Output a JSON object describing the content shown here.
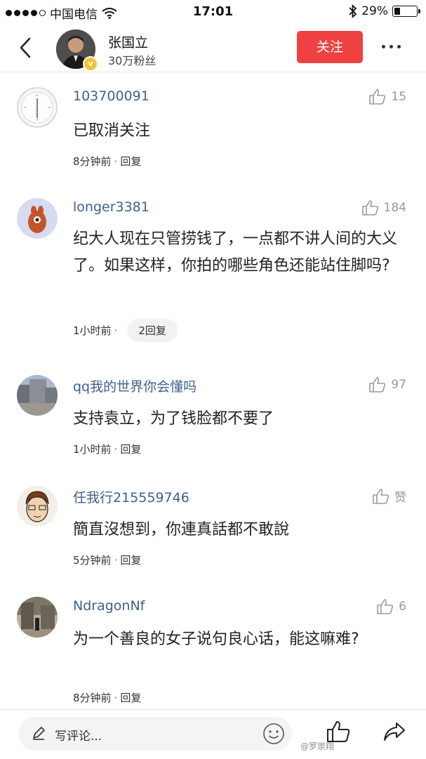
{
  "status_bar": {
    "carrier": "中国电信",
    "time": "17:01",
    "battery": "29%",
    "battery_level": 0.29
  },
  "header": {
    "author_name": "张国立",
    "author_fans": "30万粉丝",
    "follow_label": "关注"
  },
  "comments": [
    {
      "name": "103700091",
      "likes": "15",
      "text": "已取消关注",
      "time": "8分钟前",
      "sep": "·",
      "reply": "回复"
    },
    {
      "name": "longer3381",
      "likes": "184",
      "text": "纪大人现在只管捞钱了，一点都不讲人间的大义了。如果这样，你拍的哪些角色还能站住脚吗?",
      "time": "1小时前",
      "sep": "·",
      "reply": "2回复"
    },
    {
      "name": "qq我的世界你会懂吗",
      "likes": "97",
      "text": "支持袁立，为了钱脸都不要了",
      "time": "1小时前",
      "sep": "·",
      "reply": "回复"
    },
    {
      "name": "任我行215559746",
      "likes": "赞",
      "text": "簡直沒想到，你連真話都不敢說",
      "time": "5分钟前",
      "sep": "·",
      "reply": "回复"
    },
    {
      "name": "NdragonNf",
      "likes": "6",
      "text": "为一个善良的女子说句良心话，能这嘛难?",
      "time": "8分钟前",
      "sep": "·",
      "reply": "回复"
    }
  ],
  "bottom_bar": {
    "comment_placeholder": "写评论..."
  },
  "watermark": "@罗崇翔",
  "colors": {
    "accent": "#f04142",
    "username": "#40608c",
    "muted": "#9a9a9a"
  }
}
